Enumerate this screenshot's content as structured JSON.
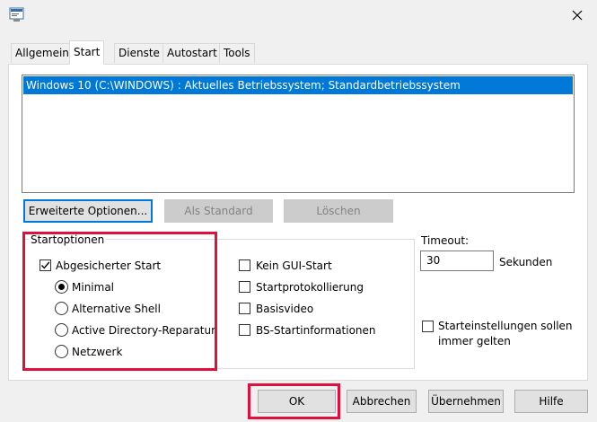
{
  "window": {
    "app_icon": "msconfig-icon",
    "close_icon": "close-icon"
  },
  "tabs": [
    {
      "label": "Allgemein"
    },
    {
      "label": "Start"
    },
    {
      "label": "Dienste"
    },
    {
      "label": "Autostart"
    },
    {
      "label": "Tools"
    }
  ],
  "active_tab": "Start",
  "os_list": {
    "items": [
      "Windows 10 (C:\\WINDOWS) : Aktuelles Betriebssystem; Standardbetriebssystem"
    ],
    "selected": 0
  },
  "buttons": {
    "advanced": "Erweiterte Optionen...",
    "set_default": "Als Standard",
    "delete": "Löschen"
  },
  "boot_options": {
    "group_label": "Startoptionen",
    "safe_boot": {
      "label": "Abgesicherter Start",
      "checked": true
    },
    "radios": [
      {
        "label": "Minimal",
        "checked": true
      },
      {
        "label": "Alternative Shell",
        "checked": false
      },
      {
        "label": "Active Directory-Reparatur",
        "checked": false
      },
      {
        "label": "Netzwerk",
        "checked": false
      }
    ],
    "right_checks": [
      {
        "label": "Kein GUI-Start",
        "checked": false
      },
      {
        "label": "Startprotokollierung",
        "checked": false
      },
      {
        "label": "Basisvideo",
        "checked": false
      },
      {
        "label": "BS-Startinformationen",
        "checked": false
      }
    ]
  },
  "timeout": {
    "label": "Timeout:",
    "value": "30",
    "unit": "Sekunden"
  },
  "permanent": {
    "line1": "Starteinstellungen sollen",
    "line2": "immer gelten",
    "checked": false
  },
  "footer": {
    "ok": "OK",
    "cancel": "Abbrechen",
    "apply": "Übernehmen",
    "help": "Hilfe"
  },
  "colors": {
    "selection": "#0078d7",
    "highlight_box": "#e0103c"
  }
}
